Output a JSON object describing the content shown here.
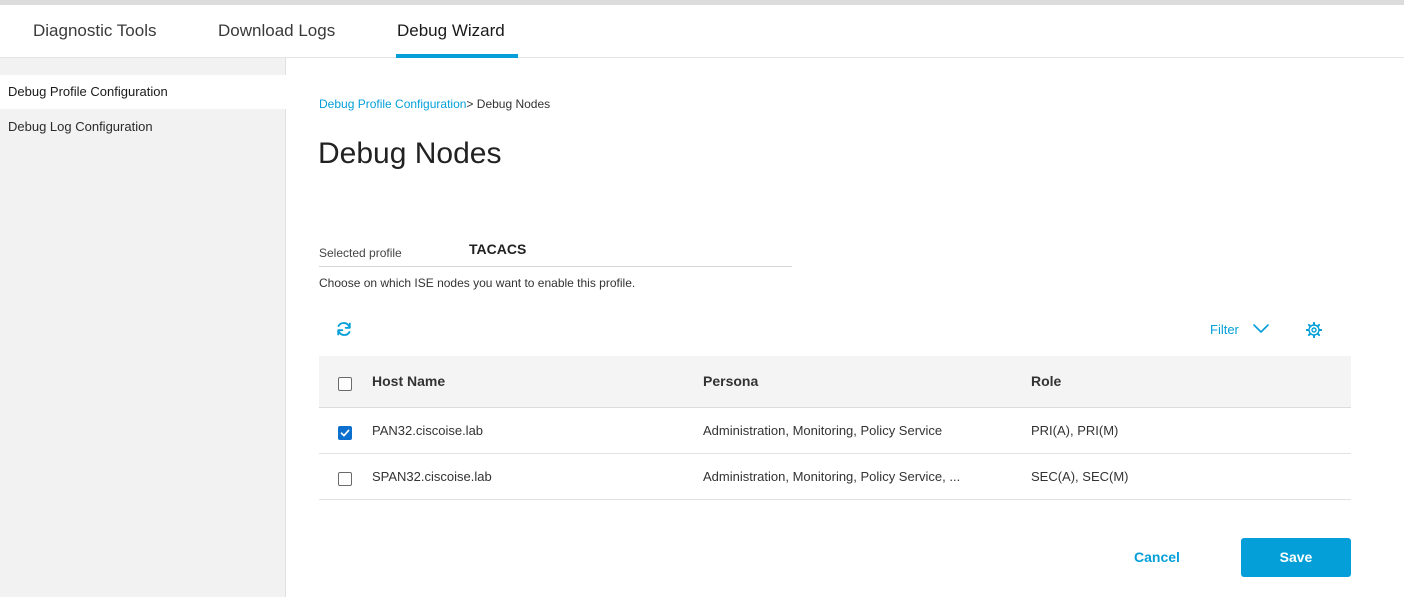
{
  "tabs": [
    {
      "label": "Diagnostic Tools",
      "active": false
    },
    {
      "label": "Download Logs",
      "active": false
    },
    {
      "label": "Debug Wizard",
      "active": true
    }
  ],
  "sidebar": {
    "items": [
      {
        "label": "Debug Profile Configuration",
        "active": true
      },
      {
        "label": "Debug Log Configuration",
        "active": false
      }
    ]
  },
  "breadcrumb": {
    "parent": "Debug Profile Configuration",
    "separator": ">",
    "current": " Debug Nodes"
  },
  "page": {
    "title": "Debug Nodes",
    "profile_label": "Selected profile",
    "profile_value": "TACACS",
    "instructions": "Choose on which ISE nodes you want to enable this profile."
  },
  "toolbar": {
    "refresh_icon": "refresh-icon",
    "filter_label": "Filter",
    "settings_icon": "gear-icon"
  },
  "table": {
    "columns": [
      "Host Name",
      "Persona",
      "Role"
    ],
    "rows": [
      {
        "checked": true,
        "host": "PAN32.ciscoise.lab",
        "persona": "Administration, Monitoring, Policy Service",
        "role": "PRI(A), PRI(M)"
      },
      {
        "checked": false,
        "host": "SPAN32.ciscoise.lab",
        "persona": "Administration, Monitoring, Policy Service, ...",
        "role": "SEC(A), SEC(M)"
      }
    ]
  },
  "actions": {
    "cancel_label": "Cancel",
    "save_label": "Save"
  },
  "colors": {
    "accent": "#049fd9",
    "checkbox_checked": "#0d6fce"
  }
}
